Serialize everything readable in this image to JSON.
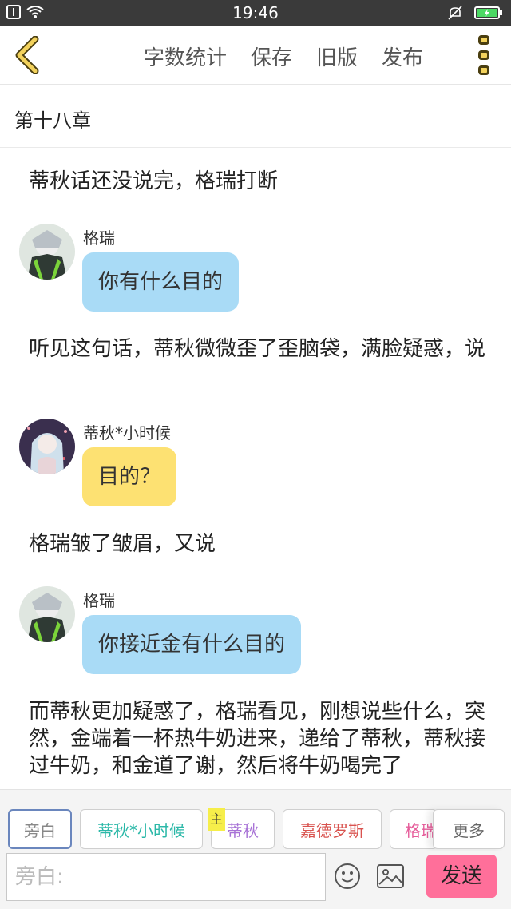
{
  "status_bar": {
    "time": "19:46"
  },
  "toolbar": {
    "actions": [
      "字数统计",
      "保存",
      "旧版",
      "发布"
    ]
  },
  "chapter": {
    "title": "第十八章"
  },
  "messages": [
    {
      "type": "narration",
      "text": "蒂秋话还没说完，格瑞打断"
    },
    {
      "type": "dialogue",
      "speaker": "格瑞",
      "text": "你有什么目的",
      "bubble_color": "#a9dbf6"
    },
    {
      "type": "narration",
      "text": "听见这句话，蒂秋微微歪了歪脑袋，满脸疑惑，说"
    },
    {
      "type": "dialogue",
      "speaker": "蒂秋*小时候",
      "text": "目的？",
      "bubble_color": "#fde172"
    },
    {
      "type": "narration",
      "text": "格瑞皱了皱眉，又说"
    },
    {
      "type": "dialogue",
      "speaker": "格瑞",
      "text": "你接近金有什么目的",
      "bubble_color": "#a9dbf6"
    },
    {
      "type": "narration",
      "text": "而蒂秋更加疑惑了，格瑞看见，刚想说些什么，突然，金端着一杯热牛奶进来，递给了蒂秋，蒂秋接过牛奶，和金道了谢，然后将牛奶喝完了"
    }
  ],
  "characters": [
    {
      "label": "旁白",
      "color": "#888888",
      "selected": true
    },
    {
      "label": "蒂秋*小时候",
      "color": "#2bb8a8"
    },
    {
      "label": "蒂秋",
      "color": "#a873d6",
      "badge": "主"
    },
    {
      "label": "嘉德罗斯",
      "color": "#d9534f"
    },
    {
      "label": "格瑞",
      "color": "#e65c9a"
    }
  ],
  "more_label": "更多",
  "input": {
    "placeholder": "旁白:"
  },
  "send_label": "发送",
  "colors": {
    "accent_yellow": "#f3d25c",
    "send_pink": "#ff6f9a",
    "bubble_blue": "#a9dbf6",
    "bubble_yellow": "#fde172"
  }
}
